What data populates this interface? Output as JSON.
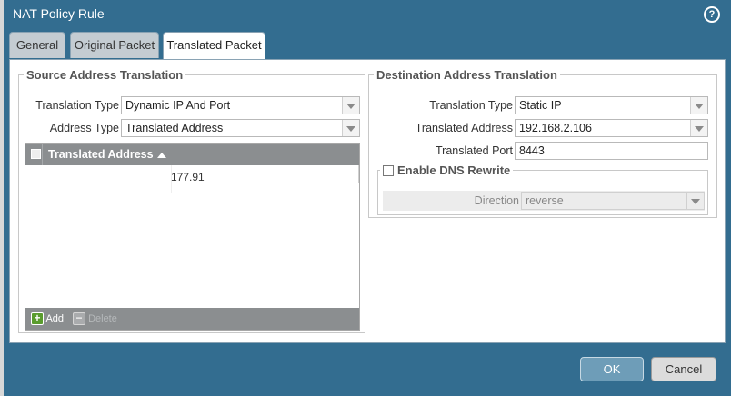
{
  "window": {
    "title": "NAT Policy Rule",
    "help_glyph": "?"
  },
  "tabs": [
    {
      "label": "General",
      "active": false
    },
    {
      "label": "Original Packet",
      "active": false
    },
    {
      "label": "Translated Packet",
      "active": true
    }
  ],
  "source": {
    "legend": "Source Address Translation",
    "translation_type": {
      "label": "Translation Type",
      "value": "Dynamic IP And Port"
    },
    "address_type": {
      "label": "Address Type",
      "value": "Translated Address"
    },
    "grid": {
      "header": "Translated Address",
      "rows": [
        "177.91"
      ],
      "add_label": "Add",
      "delete_label": "Delete"
    }
  },
  "destination": {
    "legend": "Destination Address Translation",
    "translation_type": {
      "label": "Translation Type",
      "value": "Static IP"
    },
    "translated_address": {
      "label": "Translated Address",
      "value": "192.168.2.106"
    },
    "translated_port": {
      "label": "Translated Port",
      "value": "8443"
    },
    "dns": {
      "legend": "Enable DNS Rewrite",
      "checked": false,
      "direction": {
        "label": "Direction",
        "value": "reverse"
      }
    }
  },
  "buttons": {
    "ok": "OK",
    "cancel": "Cancel"
  },
  "colors": {
    "titlebar": "#336d90",
    "grid_header": "#8b8e90",
    "ok_button": "#6e9db8"
  }
}
